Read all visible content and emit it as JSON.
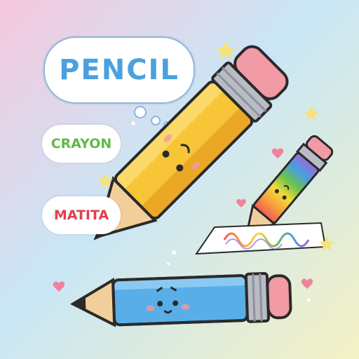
{
  "labels": {
    "pencil": "PENCIL",
    "crayon": "CRAYON",
    "matita": "MATITA"
  },
  "colors": {
    "pencil_text": "#4aa1de",
    "crayon_text": "#62b84a",
    "matita_text": "#e03f4b",
    "yellow_pencil": "#f7c537",
    "blue_pencil": "#5aaee8",
    "eraser_pink": "#f29aa6"
  },
  "icons": [
    "star-icon",
    "heart-icon",
    "sparkle-icon"
  ]
}
